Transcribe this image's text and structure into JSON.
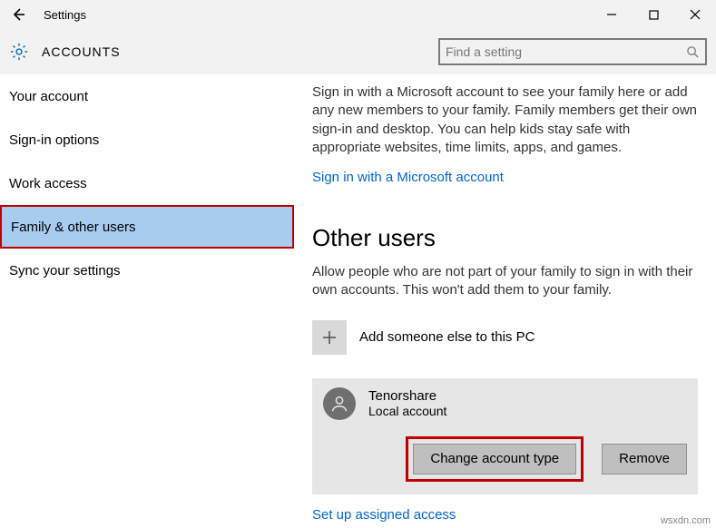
{
  "window": {
    "title": "Settings"
  },
  "header": {
    "section": "ACCOUNTS",
    "search_placeholder": "Find a setting"
  },
  "sidebar": {
    "items": [
      {
        "label": "Your account"
      },
      {
        "label": "Sign-in options"
      },
      {
        "label": "Work access"
      },
      {
        "label": "Family & other users"
      },
      {
        "label": "Sync your settings"
      }
    ]
  },
  "main": {
    "family_blurb": "Sign in with a Microsoft account to see your family here or add any new members to your family. Family members get their own sign-in and desktop. You can help kids stay safe with appropriate websites, time limits, apps, and games.",
    "signin_link": "Sign in with a Microsoft account",
    "other_users_heading": "Other users",
    "other_users_blurb": "Allow people who are not part of your family to sign in with their own accounts. This won't add them to your family.",
    "add_label": "Add someone else to this PC",
    "user": {
      "name": "Tenorshare",
      "type": "Local account"
    },
    "change_btn": "Change account type",
    "remove_btn": "Remove",
    "assigned_link": "Set up assigned access"
  },
  "watermark": "wsxdn.com"
}
